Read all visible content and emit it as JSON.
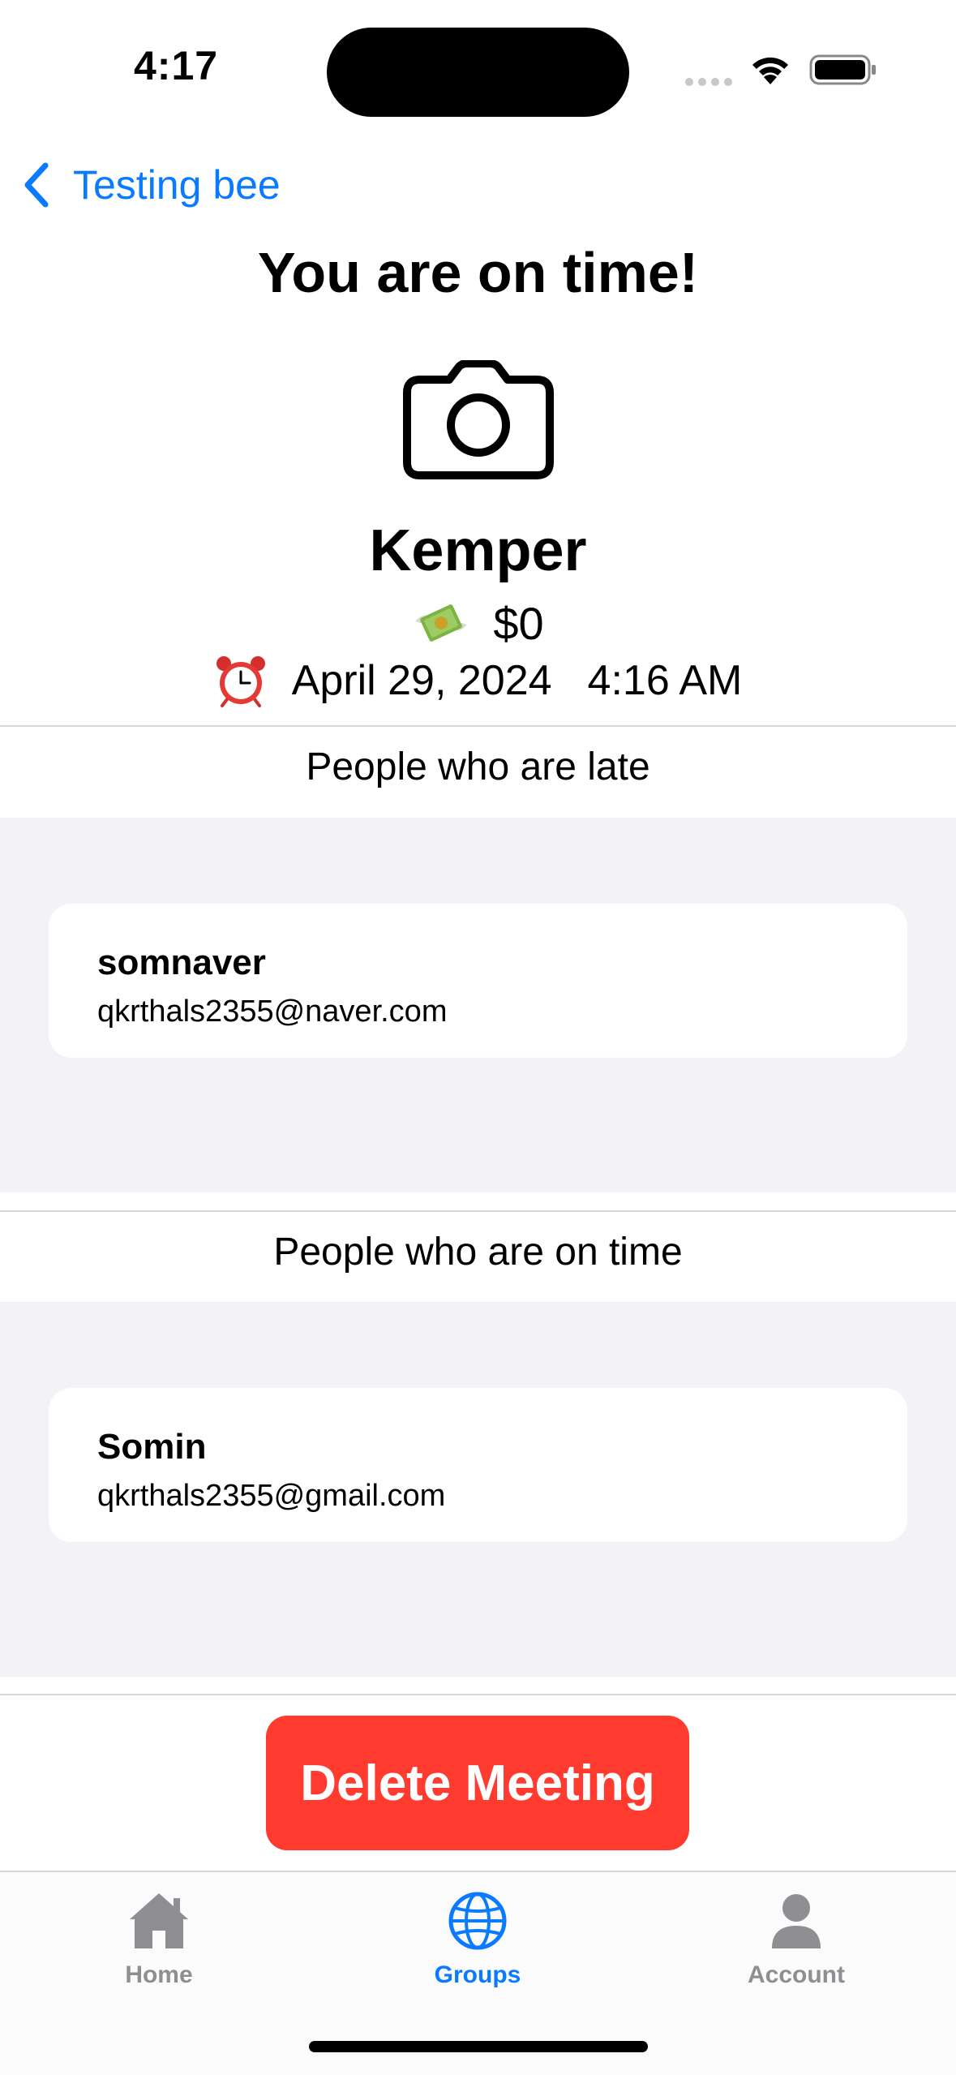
{
  "status_bar": {
    "time": "4:17"
  },
  "nav": {
    "back_label": "Testing bee"
  },
  "main": {
    "title": "You are on time!",
    "person_name": "Kemper",
    "amount": "$0",
    "date": "April 29, 2024",
    "time": "4:16 AM"
  },
  "late_section": {
    "label": "People who are late",
    "people": [
      {
        "name": "somnaver",
        "email": "qkrthals2355@naver.com"
      }
    ]
  },
  "ontime_section": {
    "label": "People who are on time",
    "people": [
      {
        "name": "Somin",
        "email": "qkrthals2355@gmail.com"
      }
    ]
  },
  "actions": {
    "delete_label": "Delete Meeting"
  },
  "tab_bar": {
    "tabs": [
      {
        "label": "Home",
        "icon": "house-icon",
        "active": false
      },
      {
        "label": "Groups",
        "icon": "globe-icon",
        "active": true
      },
      {
        "label": "Account",
        "icon": "person-icon",
        "active": false
      }
    ]
  },
  "colors": {
    "accent": "#0a7aff",
    "destructive": "#ff3b30",
    "inactive_tab": "#8e8e93",
    "list_background": "#f2f2f7"
  }
}
